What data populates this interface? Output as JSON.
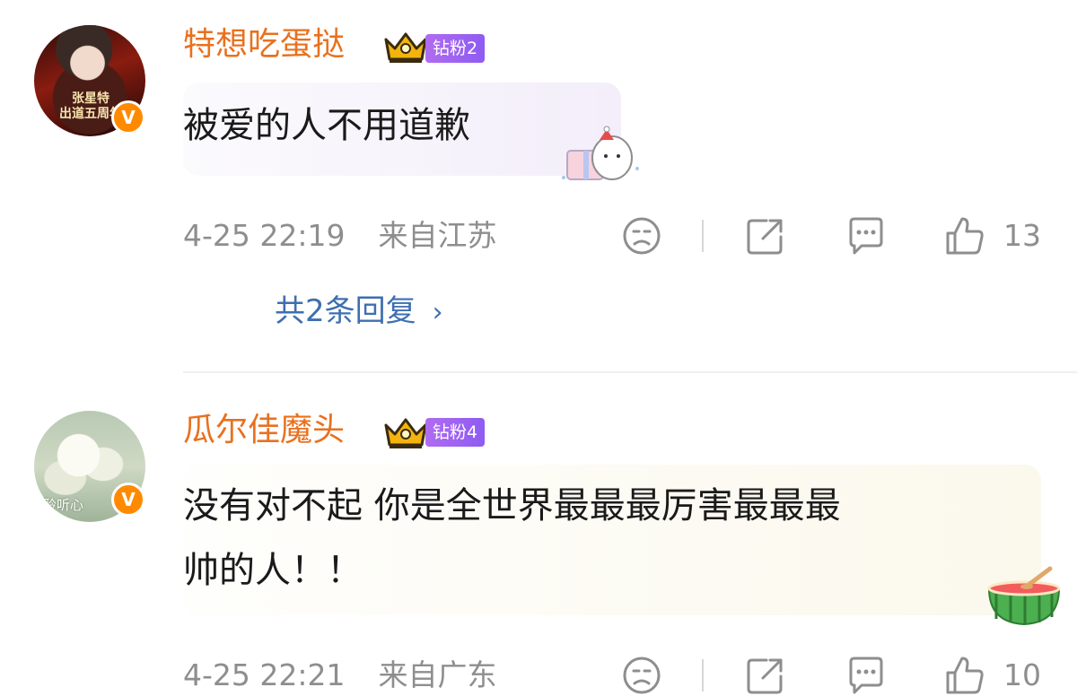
{
  "comments": [
    {
      "username": "特想吃蛋挞",
      "fan_badge": "钻粉2",
      "avatar_caption": "张星特\n出道五周年",
      "text": "被爱的人不用道歉",
      "timestamp": "4-25 22:19",
      "location": "来自江苏",
      "likes": "13",
      "replies_label": "共2条回复",
      "sticker_icon": "cat-gift-sticker"
    },
    {
      "username": "瓜尔佳魔头",
      "fan_badge": "钻粉4",
      "avatar_caption": "聆听心",
      "text_line1": "没有对不起 你是全世界最最最厉害最最最",
      "text_line2": "帅的人！！",
      "timestamp": "4-25 22:21",
      "location": "来自广东",
      "likes": "10",
      "sticker_icon": "watermelon-sticker"
    }
  ],
  "colors": {
    "username": "#e8711f",
    "badge": "#9b63f1",
    "reply_link": "#3e6fb0",
    "meta": "#8e8e8e",
    "verified": "#ff8a00"
  }
}
